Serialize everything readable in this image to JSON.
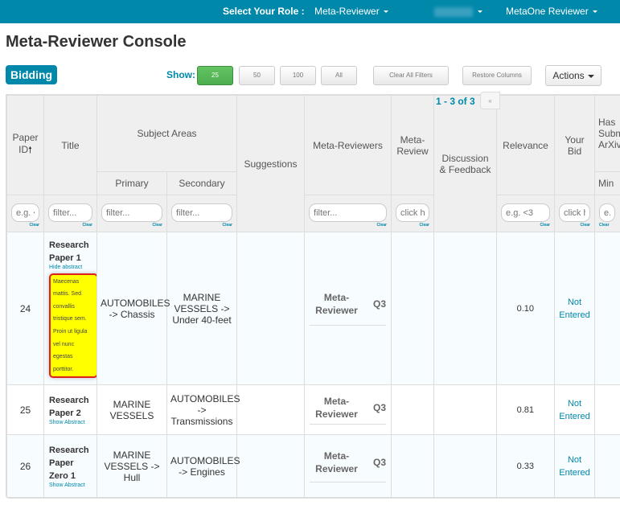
{
  "topbar": {
    "role_label": "Select Your Role :",
    "role_value": "Meta-Reviewer",
    "conference_value": "",
    "user_name": "MetaOne Reviewer",
    "accent_color": "#0088aa"
  },
  "page": {
    "title": "Meta-Reviewer Console",
    "section_badge": "Bidding"
  },
  "toolbar": {
    "show_label": "Show:",
    "page_sizes": [
      "25",
      "50",
      "100",
      "All"
    ],
    "active_page_size": "25",
    "clear_filters": "Clear All Filters",
    "restore_columns": "Restore Columns",
    "actions": "Actions"
  },
  "pagination": {
    "info": "1 - 3 of 3",
    "first": "«"
  },
  "table": {
    "headers": {
      "paper_id": "Paper ID",
      "title": "Title",
      "subject_areas": "Subject Areas",
      "primary": "Primary",
      "secondary": "Secondary",
      "suggestions": "Suggestions",
      "meta_reviewers": "Meta-Reviewers",
      "meta_review": "Meta-Review",
      "discussion": "Discussion & Feedback",
      "relevance": "Relevance",
      "your_bid": "Your Bid",
      "arxiv": "Has Submitted ArXiv",
      "min": "Min"
    },
    "filters": {
      "paper_id": "e.g. <",
      "title": "filter...",
      "primary": "filter...",
      "secondary": "filter...",
      "meta_reviewers": "filter...",
      "meta_review": "click here",
      "relevance": "e.g. <3",
      "your_bid": "click here",
      "min": "e.g.",
      "clear": "Clear"
    },
    "rows": [
      {
        "id": "24",
        "title": "Research Paper 1",
        "abstract_toggle": "Hide abstract",
        "abstract": "Maecenas mattis. Sed convallis tristique sem. Proin ut ligula vel nunc egestas porttitor.",
        "primary": "AUTOMOBILES -> Chassis",
        "secondary": "MARINE VESSELS -> Under 40-feet",
        "meta_reviewer": "Meta-Reviewer",
        "meta_reviewer_q": "Q3",
        "relevance": "0.10",
        "bid": "Not Entered"
      },
      {
        "id": "25",
        "title": "Research Paper 2",
        "abstract_toggle": "Show Abstract",
        "primary": "MARINE VESSELS",
        "secondary": "AUTOMOBILES -> Transmissions",
        "meta_reviewer": "Meta-Reviewer",
        "meta_reviewer_q": "Q3",
        "relevance": "0.81",
        "bid": "Not Entered"
      },
      {
        "id": "26",
        "title": "Research Paper Zero 1",
        "abstract_toggle": "Show Abstract",
        "primary": "MARINE VESSELS -> Hull",
        "secondary": "AUTOMOBILES -> Engines",
        "meta_reviewer": "Meta-Reviewer",
        "meta_reviewer_q": "Q3",
        "relevance": "0.33",
        "bid": "Not Entered"
      }
    ]
  }
}
